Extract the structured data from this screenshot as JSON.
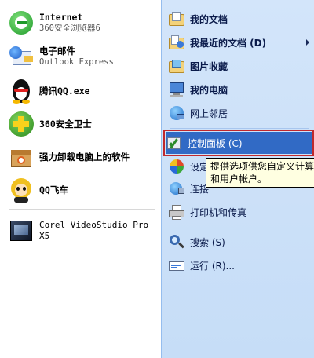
{
  "left_items": [
    {
      "title": "Internet",
      "sub": "360安全浏览器6",
      "icon": "browser-360-icon"
    },
    {
      "title": "电子邮件",
      "sub": "Outlook Express",
      "icon": "outlook-express-icon"
    },
    {
      "title": "腾讯QQ.exe",
      "sub": "",
      "icon": "qq-penguin-icon"
    },
    {
      "title": "360安全卫士",
      "sub": "",
      "icon": "360-security-icon"
    },
    {
      "title": "强力卸载电脑上的软件",
      "sub": "",
      "icon": "uninstaller-icon"
    },
    {
      "title": "QQ飞车",
      "sub": "",
      "icon": "qq-speed-icon"
    },
    {
      "title": "Corel VideoStudio Pro",
      "sub": "X5",
      "icon": "corel-videostudio-icon"
    }
  ],
  "right_items": [
    {
      "label": "我的文档",
      "icon": "my-documents-icon"
    },
    {
      "label": "我最近的文档 (D)",
      "icon": "recent-documents-icon"
    },
    {
      "label": "图片收藏",
      "icon": "my-pictures-icon"
    },
    {
      "label": "我的电脑",
      "icon": "my-computer-icon"
    },
    {
      "label": "网上邻居",
      "icon": "network-places-icon"
    },
    {
      "label": "控制面板 (C)",
      "icon": "control-panel-icon"
    },
    {
      "label": "设定",
      "icon": "set-program-access-icon"
    },
    {
      "label": "连接",
      "icon": "connect-to-icon"
    },
    {
      "label": "打印机和传真",
      "icon": "printers-faxes-icon"
    },
    {
      "label": "搜索 (S)",
      "icon": "search-icon"
    },
    {
      "label": "运行 (R)...",
      "icon": "run-icon"
    }
  ],
  "tooltip": {
    "line1": "提供选项供您自定义计算",
    "line2": "和用户帐户。"
  },
  "colors": {
    "right_pane_bg": "#d3e5fa",
    "highlight": "#316ac5",
    "highlight_outline": "#c0282d",
    "tooltip_bg": "#ffffe1"
  }
}
